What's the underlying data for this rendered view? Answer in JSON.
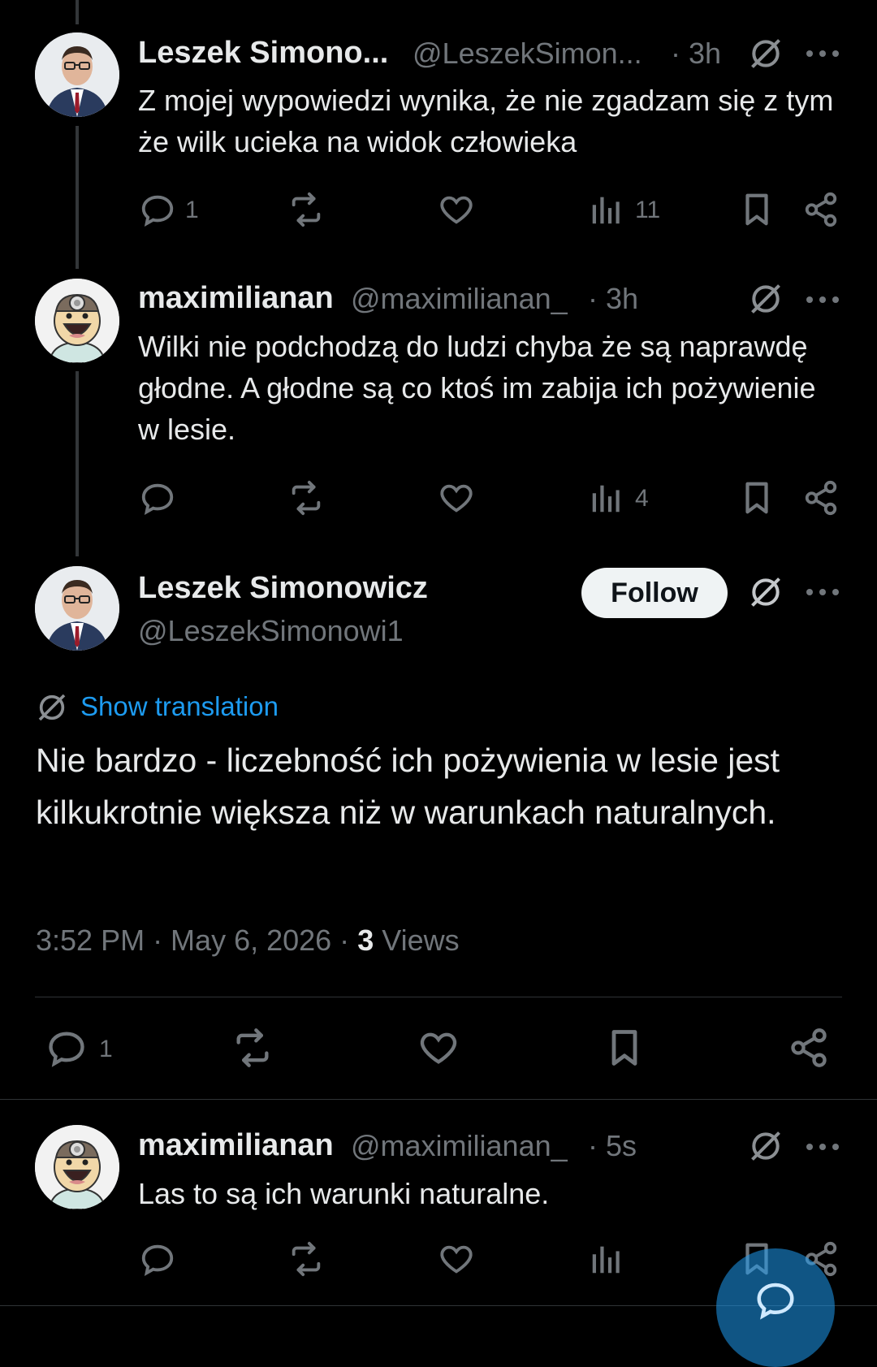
{
  "tweets": [
    {
      "name": "Leszek Simono...",
      "handle": "@LeszekSimon...",
      "time": "· 3h",
      "text": "Z mojej wypowiedzi wynika, że nie zgadzam się z tym że wilk ucieka na widok człowieka",
      "replies": "1",
      "views": "11"
    },
    {
      "name": "maximilianan",
      "handle": "@maximilianan_",
      "time": "· 3h",
      "text": "Wilki nie podchodzą do ludzi chyba że są naprawdę głodne. A głodne są co ktoś im zabija ich pożywienie w lesie.",
      "replies": "",
      "views": "4"
    }
  ],
  "main_tweet": {
    "name": "Leszek Simonowicz",
    "handle": "@LeszekSimonowi1",
    "follow_label": "Follow",
    "show_translation": "Show translation",
    "text": "Nie bardzo - liczebność ich pożywienia w lesie jest kilkukrotnie większa niż w warunkach naturalnych.",
    "timestamp": "3:52 PM · May 6, 2026 ·",
    "views_count": "3",
    "views_label": "Views",
    "replies": "1"
  },
  "reply": {
    "name": "maximilianan",
    "handle": "@maximilianan_",
    "time": "· 5s",
    "text": "Las to są ich warunki naturalne."
  },
  "colors": {
    "background": "#000000",
    "text": "#e7e9ea",
    "muted": "#71767b",
    "link": "#1d9bf0",
    "fab": "#1d9bf0"
  },
  "icons": [
    "reply-icon",
    "retweet-icon",
    "like-icon",
    "views-icon",
    "bookmark-icon",
    "share-icon",
    "grok-icon",
    "more-icon",
    "compose-reply-icon"
  ]
}
